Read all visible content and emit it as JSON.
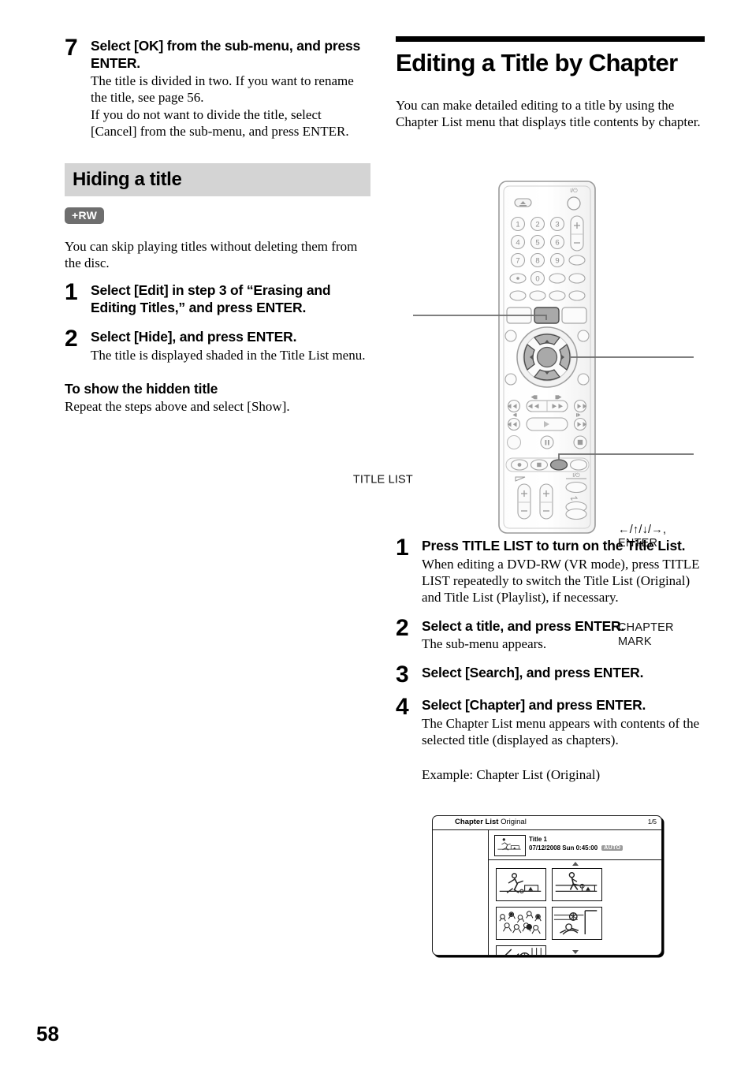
{
  "page_number": "58",
  "left_column": {
    "step7": {
      "num": "7",
      "title": "Select [OK] from the sub-menu, and press ENTER.",
      "body_line1": "The title is divided in two. If you want to rename the title, see page 56.",
      "body_line2": "If you do not want to divide the title, select [Cancel] from the sub-menu, and press ENTER."
    },
    "section": {
      "heading": "Hiding a title",
      "disc_badge": "+RW",
      "intro": "You can skip playing titles without deleting them from the disc.",
      "step1": {
        "num": "1",
        "title": "Select [Edit] in step 3 of “Erasing and Editing Titles,” and press ENTER."
      },
      "step2": {
        "num": "2",
        "title": "Select [Hide], and press ENTER.",
        "body": "The title is displayed shaded in the Title List menu."
      },
      "sub_head": "To show the hidden title",
      "sub_body": "Repeat the steps above and select [Show]."
    }
  },
  "right_column": {
    "title": "Editing a Title by Chapter",
    "intro": "You can make detailed editing to a title by using the Chapter List menu that displays title contents by chapter.",
    "remote_callouts": {
      "title_list": "TITLE LIST",
      "dpad_line1": "←/↑/↓/→,",
      "dpad_line2": "ENTER",
      "chapter_mark_line1": "CHAPTER",
      "chapter_mark_line2": "MARK"
    },
    "remote_keys": {
      "power": "I/⏻",
      "eject": "eject",
      "numbers": [
        "1",
        "2",
        "3",
        "4",
        "5",
        "6",
        "7",
        "8",
        "9",
        "0"
      ],
      "volume_plus": "+",
      "volume_minus": "−"
    },
    "step1": {
      "num": "1",
      "title": "Press TITLE LIST to turn on the Title List.",
      "body": "When editing a DVD-RW (VR mode), press TITLE LIST repeatedly to switch the Title List (Original) and Title List (Playlist), if necessary."
    },
    "step2": {
      "num": "2",
      "title": "Select a title, and press ENTER.",
      "body": "The sub-menu appears."
    },
    "step3": {
      "num": "3",
      "title": "Select [Search], and press ENTER."
    },
    "step4": {
      "num": "4",
      "title": "Select [Chapter] and press ENTER.",
      "body": "The Chapter List menu appears with contents of the selected title (displayed as chapters)."
    },
    "example_label": "Example: Chapter List (Original)",
    "chapter_list_screen": {
      "menu_title_bold": "Chapter List",
      "menu_title_mode": "Original",
      "page_indicator": "1/5",
      "title_name": "Title 1",
      "title_meta": "07/12/2008   Sun   0:45:00",
      "rec_mode_badge": "AUTO",
      "thumbnail_count": 5
    }
  }
}
